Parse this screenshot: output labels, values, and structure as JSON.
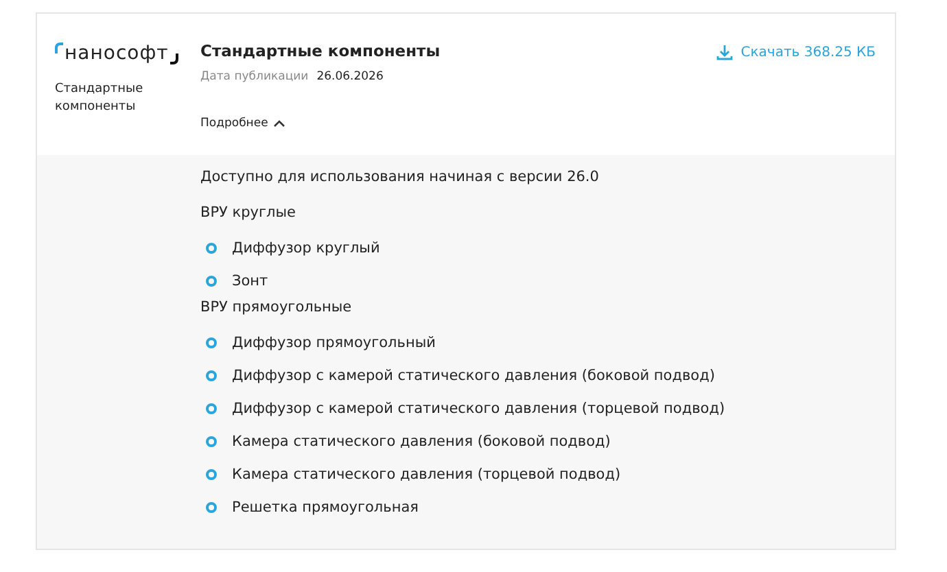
{
  "logo": {
    "text": "нанософт",
    "caption": "Стандартные компоненты"
  },
  "title": "Стандартные компоненты",
  "date": {
    "label": "Дата публикации",
    "value": "26.06.2026"
  },
  "download": {
    "label": "Скачать 368.25 КБ"
  },
  "details": {
    "label": "Подробнее",
    "expanded": true
  },
  "intro": "Доступно для использования начиная с версии 26.0",
  "groups": [
    {
      "heading": "ВРУ круглые",
      "items": [
        "Диффузор круглый",
        "Зонт"
      ]
    },
    {
      "heading": "ВРУ прямоугольные",
      "items": [
        "Диффузор прямоугольный",
        "Диффузор с камерой статического давления (боковой подвод)",
        "Диффузор с камерой статического давления (торцевой подвод)",
        "Камера статического давления (боковой подвод)",
        "Камера статического давления (торцевой подвод)",
        "Решетка прямоугольная"
      ]
    }
  ]
}
